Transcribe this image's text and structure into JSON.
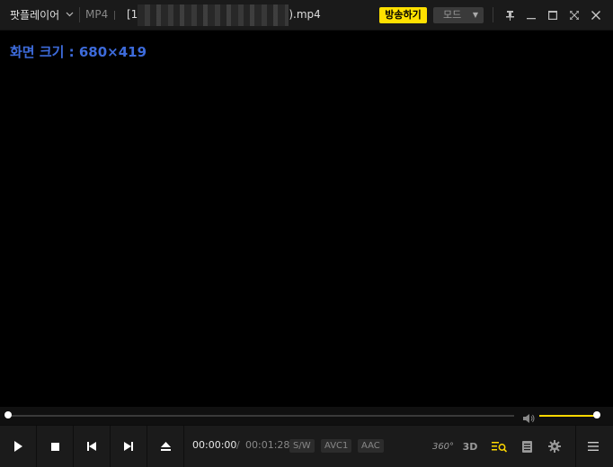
{
  "titlebar": {
    "app_menu_label": "팟플레이어",
    "format": "MP4",
    "filename_prefix": "[1",
    "filename_suffix": ").mp4",
    "broadcast_label": "방송하기",
    "mode_label": "모드"
  },
  "video": {
    "screen_size_text": "화면 크기 : 680×419"
  },
  "seek": {
    "progress_fraction": 0.0
  },
  "volume": {
    "level_fraction": 1.0
  },
  "controls": {
    "time_current": "00:00:00",
    "time_separator": "/",
    "time_total": "00:01:28",
    "codecs": [
      "S/W",
      "AVC1",
      "AAC"
    ],
    "vr_label": "360°",
    "three_d_label": "3D"
  },
  "colors": {
    "accent_yellow": "#ffe000",
    "screen_size_blue": "#3d6bdb"
  },
  "icons": [
    "chevron-down-icon",
    "pin-icon",
    "minimize-icon",
    "maximize-icon",
    "fullscreen-icon",
    "close-icon",
    "volume-icon",
    "play-icon",
    "stop-icon",
    "previous-icon",
    "next-icon",
    "eject-icon",
    "vr-360-icon",
    "3d-icon",
    "playlist-search-icon",
    "chapter-list-icon",
    "settings-gear-icon",
    "menu-icon"
  ]
}
